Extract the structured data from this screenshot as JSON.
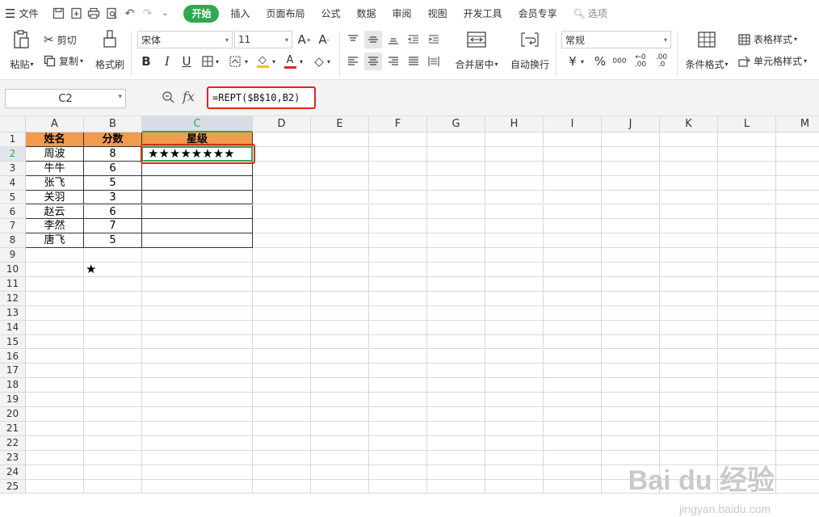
{
  "menubar": {
    "file_label": "文件",
    "quick_icons": [
      "save-icon",
      "export-pdf-icon",
      "print-icon",
      "print-preview-icon",
      "undo-icon",
      "redo-icon",
      "more-icon"
    ],
    "tabs": [
      "开始",
      "插入",
      "页面布局",
      "公式",
      "数据",
      "审阅",
      "视图",
      "开发工具",
      "会员专享"
    ],
    "active_tab": "开始",
    "search_label": "选项"
  },
  "ribbon": {
    "paste": "粘贴",
    "cut": "剪切",
    "copy": "复制",
    "format_painter": "格式刷",
    "font_name": "宋体",
    "font_size": "11",
    "merge_center": "合并居中",
    "wrap_text": "自动换行",
    "number_format": "常规",
    "conditional_format": "条件格式",
    "table_style": "表格样式",
    "cell_style": "单元格样式",
    "currency": "¥",
    "percent": "%",
    "thousands": "000",
    "inc_decimal": ".0",
    "dec_decimal": ".00",
    "font_color": "#e0251b",
    "fill_color": "#f5c400"
  },
  "formula_bar": {
    "name_box": "C2",
    "fx": "fx",
    "formula": "=REPT($B$10,B2)"
  },
  "sheet": {
    "columns": [
      "A",
      "B",
      "C",
      "D",
      "E",
      "F",
      "G",
      "H",
      "I",
      "J",
      "K",
      "L",
      "M"
    ],
    "rows": [
      "1",
      "2",
      "3",
      "4",
      "5",
      "6",
      "7",
      "8",
      "9",
      "10",
      "11",
      "12",
      "13",
      "14",
      "15",
      "16",
      "17",
      "18",
      "19",
      "20",
      "21",
      "22",
      "23",
      "24",
      "25"
    ],
    "headers": [
      "姓名",
      "分数",
      "星级"
    ],
    "data": [
      {
        "name": "周波",
        "score": "8",
        "stars": "★★★★★★★★"
      },
      {
        "name": "牛牛",
        "score": "6",
        "stars": ""
      },
      {
        "name": "张飞",
        "score": "5",
        "stars": ""
      },
      {
        "name": "关羽",
        "score": "3",
        "stars": ""
      },
      {
        "name": "赵云",
        "score": "6",
        "stars": ""
      },
      {
        "name": "李然",
        "score": "7",
        "stars": ""
      },
      {
        "name": "唐飞",
        "score": "5",
        "stars": ""
      }
    ],
    "b10": "★",
    "header_fill": "#f29a4d",
    "selection_color": "#2fa84f"
  },
  "watermark": {
    "main": "Bai du 经验",
    "sub": "jingyan.baidu.com"
  }
}
